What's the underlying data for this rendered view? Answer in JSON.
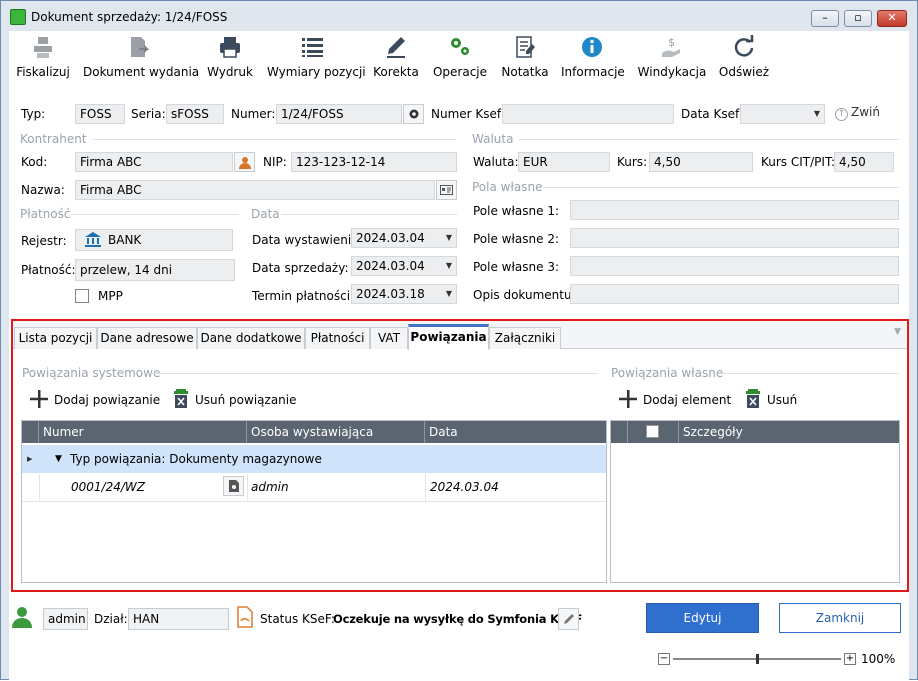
{
  "window": {
    "title": "Dokument sprzedaży: 1/24/FOSS",
    "minimize": "–",
    "maximize": "▫",
    "close": "✕"
  },
  "toolbar": [
    {
      "label": "Fiskalizuj",
      "icon": "fiscal-printer-icon"
    },
    {
      "label": "Dokument wydania",
      "icon": "document-arrow-icon"
    },
    {
      "label": "Wydruk",
      "icon": "printer-icon"
    },
    {
      "label": "Wymiary pozycji",
      "icon": "list-icon"
    },
    {
      "label": "Korekta",
      "icon": "pencil-icon"
    },
    {
      "label": "Operacje",
      "icon": "gears-icon"
    },
    {
      "label": "Notatka",
      "icon": "note-icon"
    },
    {
      "label": "Informacje",
      "icon": "info-icon"
    },
    {
      "label": "Windykacja",
      "icon": "money-hand-icon"
    },
    {
      "label": "Odśwież",
      "icon": "refresh-icon"
    }
  ],
  "header": {
    "typ_label": "Typ:",
    "typ": "FOSS",
    "seria_label": "Seria:",
    "seria": "sFOSS",
    "numer_label": "Numer:",
    "numer": "1/24/FOSS",
    "numer_ksef_label": "Numer Ksef:",
    "numer_ksef": "",
    "data_ksef_label": "Data Ksef:",
    "data_ksef": "",
    "zwin_label": "Zwiń"
  },
  "kontrahent": {
    "section": "Kontrahent",
    "kod_label": "Kod:",
    "kod": "Firma ABC",
    "nip_label": "NIP:",
    "nip": "123-123-12-14",
    "nazwa_label": "Nazwa:",
    "nazwa": "Firma ABC"
  },
  "waluta": {
    "section": "Waluta",
    "waluta_label": "Waluta:",
    "waluta": "EUR",
    "kurs_label": "Kurs:",
    "kurs": "4,50",
    "kurs_cit_label": "Kurs CIT/PIT:",
    "kurs_cit": "4,50"
  },
  "pola": {
    "section": "Pola własne",
    "p1_label": "Pole własne 1:",
    "p2_label": "Pole własne 2:",
    "p3_label": "Pole własne 3:",
    "opis_label": "Opis dokumentu:"
  },
  "platnosc": {
    "section": "Płatność",
    "rejestr_label": "Rejestr:",
    "rejestr": "BANK",
    "platnosc_label": "Płatność:",
    "platnosc": "przelew, 14 dni",
    "mpp_label": "MPP"
  },
  "data": {
    "section": "Data",
    "wyst_label": "Data wystawienia:",
    "wyst": "2024.03.04",
    "sprz_label": "Data sprzedaży:",
    "sprz": "2024.03.04",
    "term_label": "Termin płatności:",
    "term": "2024.03.18"
  },
  "tabs": [
    "Lista pozycji",
    "Dane adresowe",
    "Dane dodatkowe",
    "Płatności",
    "VAT",
    "Powiązania",
    "Załączniki"
  ],
  "active_tab": "Powiązania",
  "powiazania_systemowe": {
    "section": "Powiązania systemowe",
    "add_label": "Dodaj powiązanie",
    "remove_label": "Usuń powiązanie",
    "columns": [
      "Numer",
      "Osoba wystawiająca",
      "Data"
    ],
    "group_label": "Typ powiązania: Dokumenty magazynowe",
    "rows": [
      {
        "numer": "0001/24/WZ",
        "osoba": "admin",
        "data": "2024.03.04"
      }
    ]
  },
  "powiazania_wlasne": {
    "section": "Powiązania własne",
    "add_label": "Dodaj element",
    "remove_label": "Usuń",
    "columns": [
      "Szczegóły"
    ]
  },
  "footer": {
    "user": "admin",
    "dzial_label": "Dział:",
    "dzial": "HAN",
    "status_label": "Status KSeF:",
    "status": "Oczekuje na wysyłkę do Symfonia KSeF",
    "edit_label": "Edytuj",
    "close_label": "Zamknij",
    "zoom_minus": "−",
    "zoom_plus": "+",
    "zoom": "100%",
    "zoom_level": 0.5
  },
  "colors": {
    "accent": "#2f6fce",
    "active_tab": "#4472c4",
    "highlight": "#e01a1a",
    "group_row": "#cfe3fb"
  }
}
